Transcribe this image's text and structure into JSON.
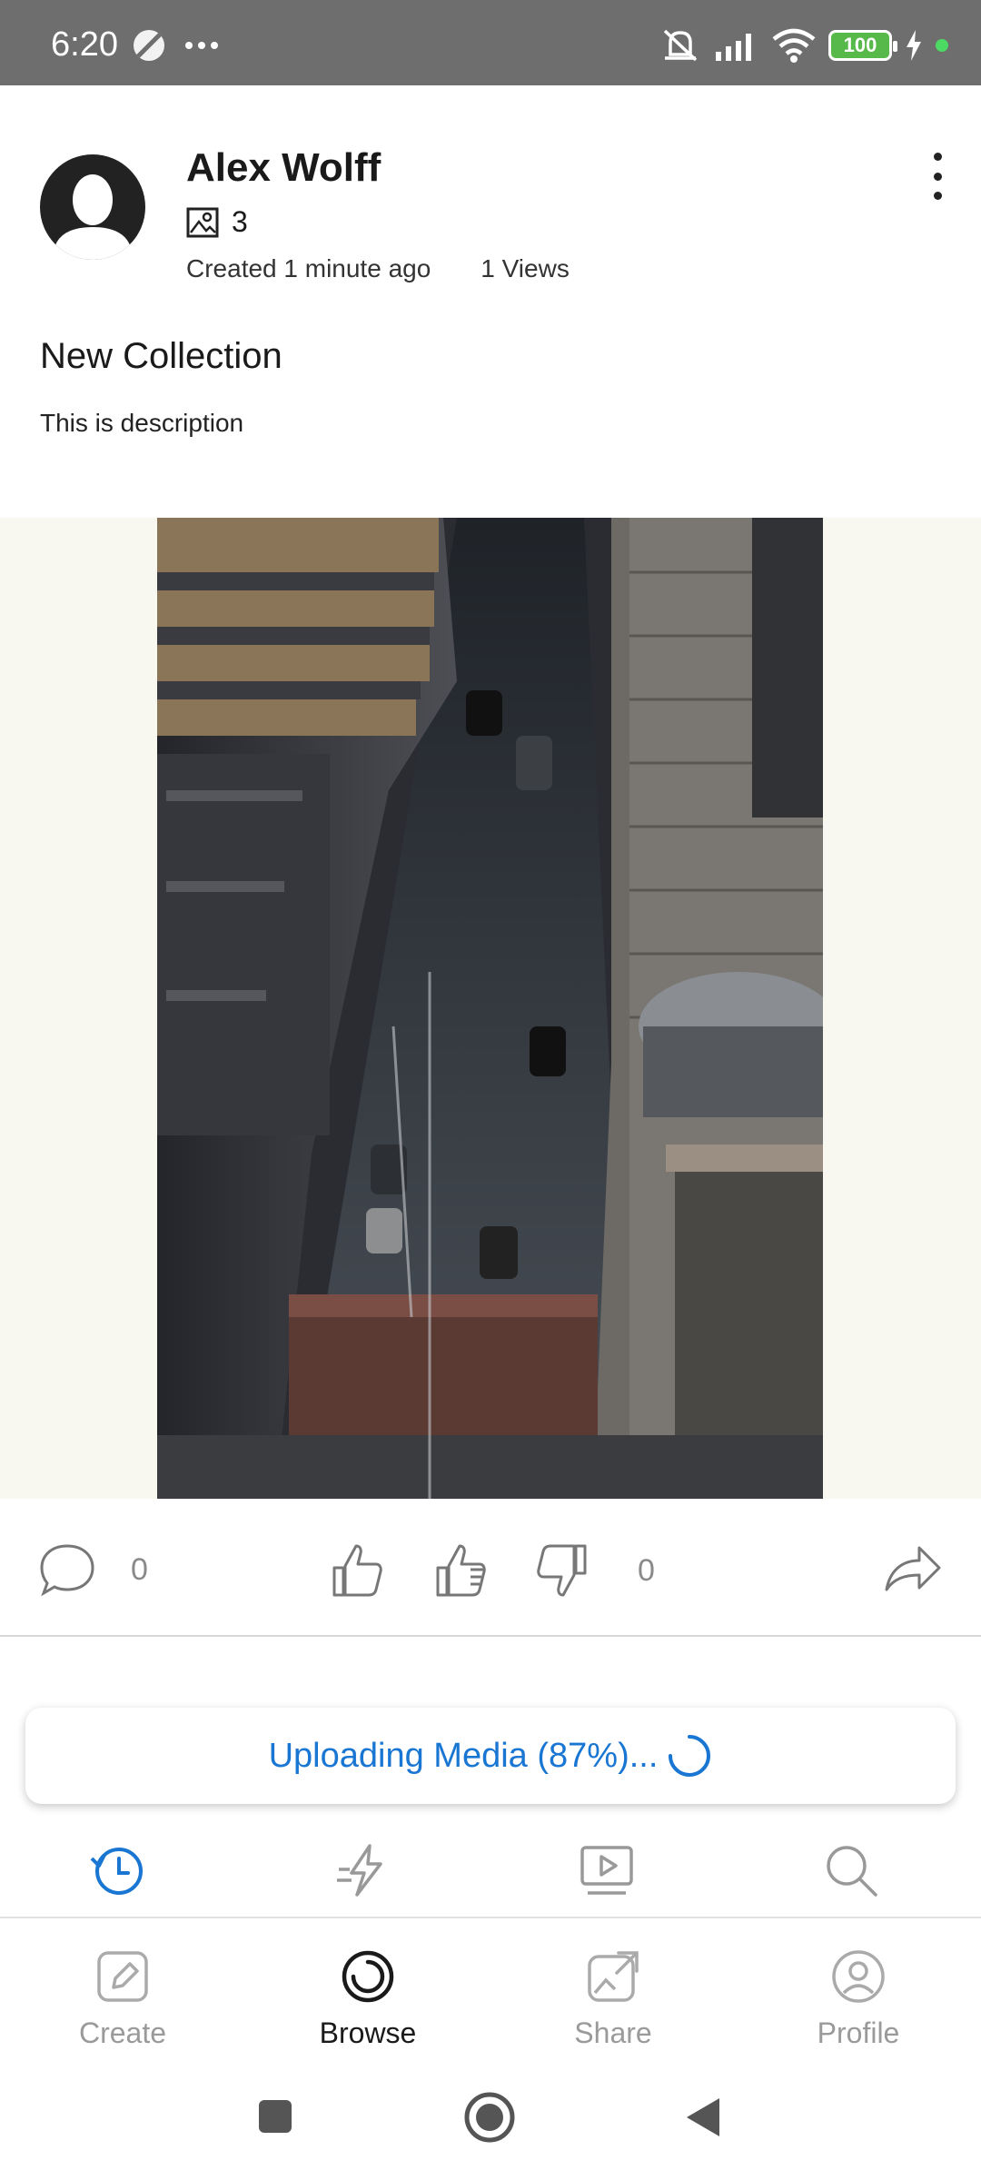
{
  "status_bar": {
    "time": "6:20",
    "battery": "100",
    "icons": [
      "dnd-icon",
      "more-icon",
      "mute-icon",
      "signal-icon",
      "wifi-icon",
      "battery-icon",
      "charging-icon"
    ]
  },
  "post": {
    "author": "Alex Wolff",
    "media_count": "3",
    "created": "Created 1 minute ago",
    "views": "1 Views",
    "collection_title": "New Collection",
    "description": "This is description"
  },
  "actions": {
    "comments_count": "0",
    "votes_count": "0"
  },
  "upload": {
    "label": "Uploading Media  (87%)...",
    "progress_percent": 87
  },
  "sub_nav": [
    "recent-icon",
    "trending-icon",
    "video-icon",
    "search-icon"
  ],
  "bottom_nav": {
    "items": [
      {
        "label": "Create",
        "active": false
      },
      {
        "label": "Browse",
        "active": true
      },
      {
        "label": "Share",
        "active": false
      },
      {
        "label": "Profile",
        "active": false
      }
    ]
  },
  "colors": {
    "accent": "#1976d2",
    "status_bar": "#6e6e6e",
    "media_bg": "#f8f7f0"
  }
}
